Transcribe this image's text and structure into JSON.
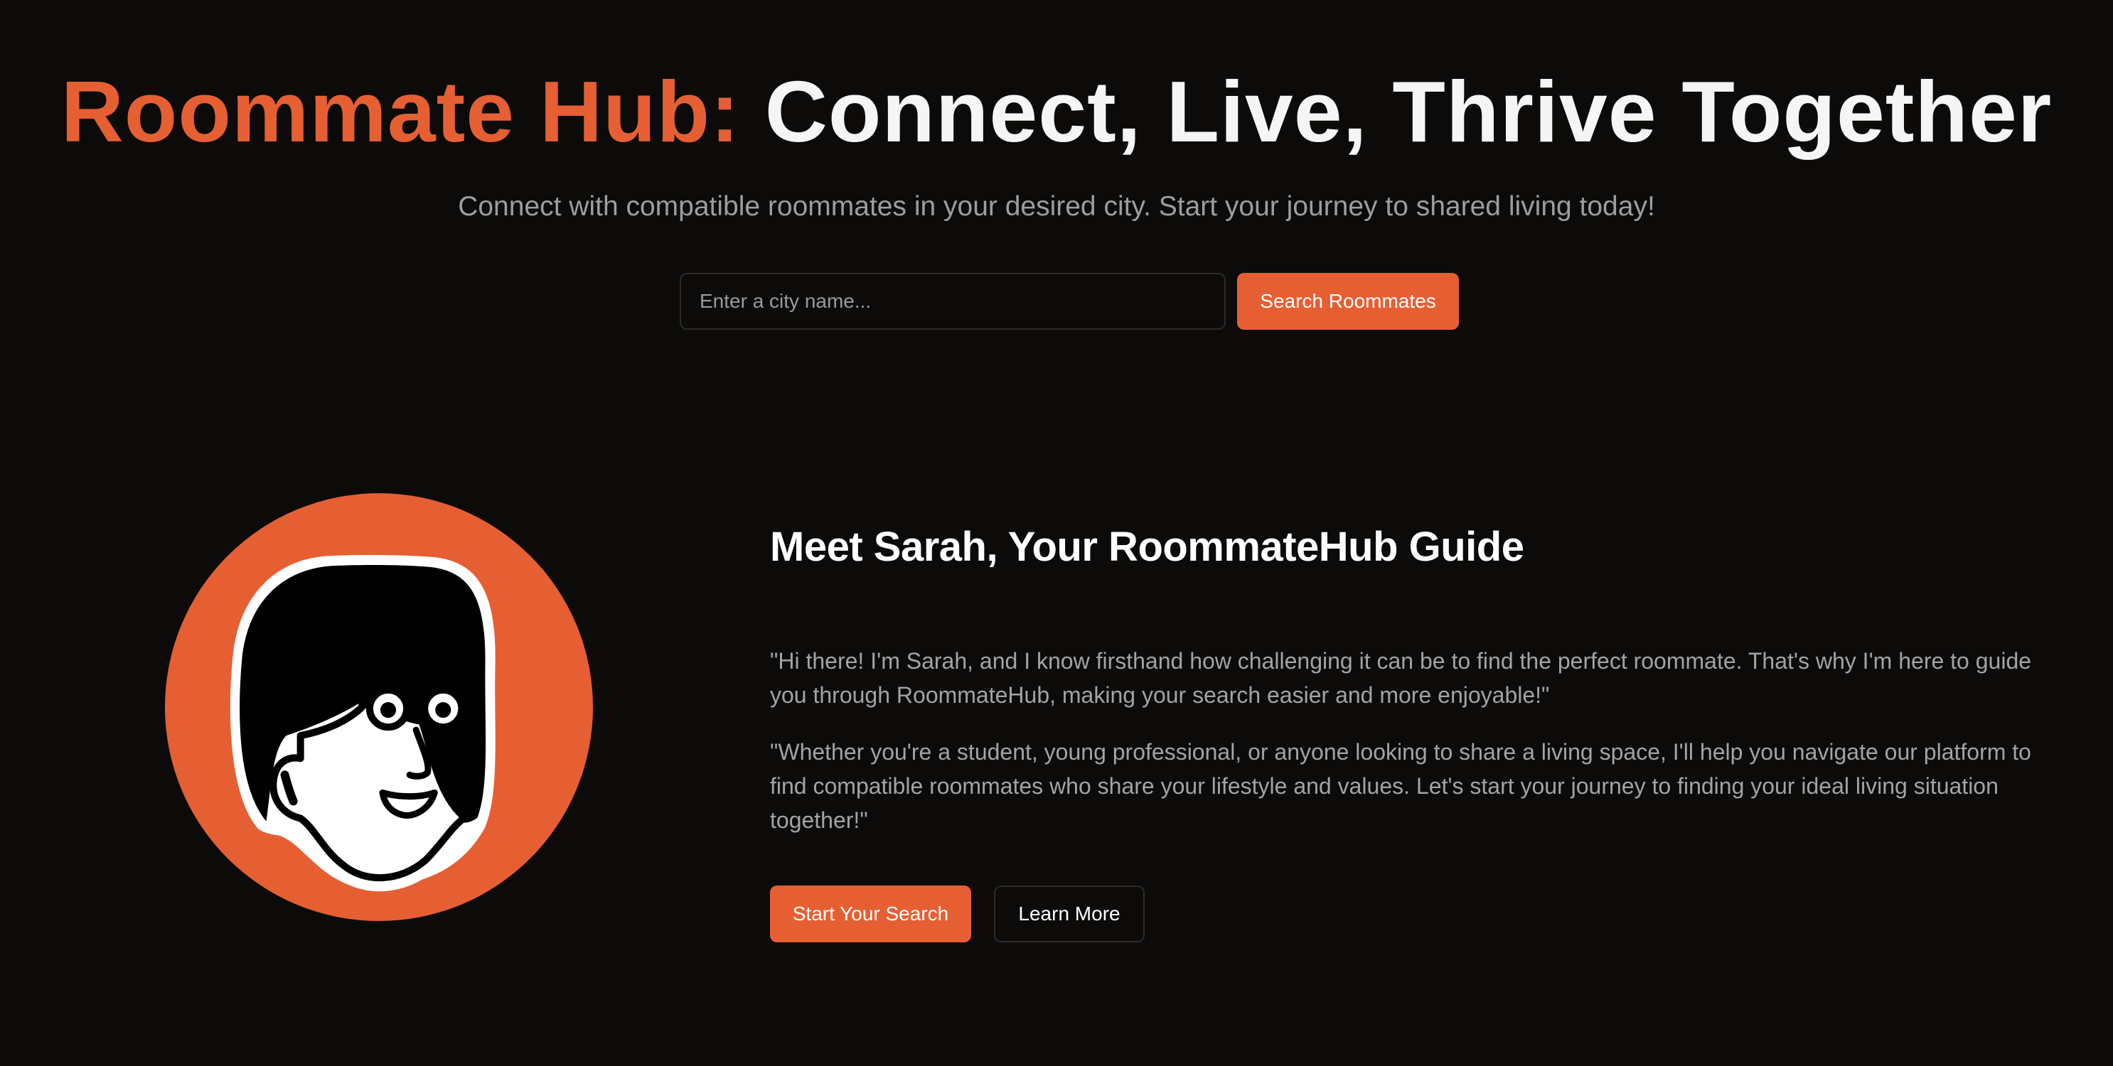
{
  "hero": {
    "title_accent": "Roommate Hub:",
    "title_rest": "Connect, Live, Thrive Together",
    "subtitle": "Connect with compatible roommates in your desired city. Start your journey to shared living today!",
    "search": {
      "placeholder": "Enter a city name...",
      "value": "",
      "button_label": "Search Roommates"
    }
  },
  "guide": {
    "heading": "Meet Sarah, Your RoommateHub Guide",
    "quotes": [
      "\"Hi there! I'm Sarah, and I know firsthand how challenging it can be to find the perfect roommate. That's why I'm here to guide you through RoommateHub, making your search easier and more enjoyable!\"",
      "\"Whether you're a student, young professional, or anyone looking to share a living space, I'll help you navigate our platform to find compatible roommates who share your lifestyle and values. Let's start your journey to finding your ideal living situation together!\""
    ],
    "primary_button": "Start Your Search",
    "secondary_button": "Learn More",
    "avatar_icon": "sarah-avatar-illustration"
  },
  "colors": {
    "background": "#0c0b0a",
    "accent": "#e65f33",
    "muted_text": "#a3a3a3",
    "border": "#2c2b2a"
  }
}
